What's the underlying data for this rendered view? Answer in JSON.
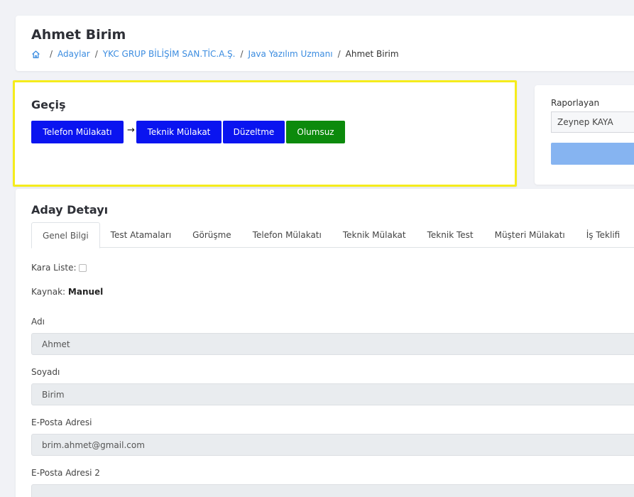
{
  "header": {
    "title": "Ahmet Birim",
    "breadcrumb": {
      "home_icon": "home-icon",
      "items": [
        "Adaylar",
        "YKC GRUP BİLİŞİM SAN.TİC.A.Ş.",
        "Java Yazılım Uzmanı"
      ],
      "current": "Ahmet Birim",
      "separator": "/"
    }
  },
  "transition": {
    "title": "Geçiş",
    "arrow": "→",
    "buttons": [
      {
        "label": "Telefon Mülakatı",
        "color": "#0a14f0"
      },
      {
        "label": "Teknik Mülakat",
        "color": "#0a14f0"
      },
      {
        "label": "Düzeltme",
        "color": "#0a14f0"
      },
      {
        "label": "Olumsuz",
        "color": "#0c8a0c"
      }
    ],
    "highlight_color": "#f5ec1c"
  },
  "reporter": {
    "label": "Raporlayan",
    "selected": "Zeynep KAYA",
    "button_color": "#86b4f1"
  },
  "detail": {
    "title": "Aday Detayı",
    "tabs": [
      "Genel Bilgi",
      "Test Atamaları",
      "Görüşme",
      "Telefon Mülakatı",
      "Teknik Mülakat",
      "Teknik Test",
      "Müşteri Mülakatı",
      "İş Teklifi"
    ],
    "active_tab": "Genel Bilgi",
    "blacklist_label": "Kara Liste:",
    "blacklist_checked": false,
    "source_label": "Kaynak:",
    "source_value": "Manuel",
    "fields": [
      {
        "label": "Adı",
        "value": "Ahmet"
      },
      {
        "label": "Soyadı",
        "value": "Birim"
      },
      {
        "label": "E-Posta Adresi",
        "value": "brim.ahmet@gmail.com"
      },
      {
        "label": "E-Posta Adresi 2",
        "value": ""
      }
    ]
  }
}
